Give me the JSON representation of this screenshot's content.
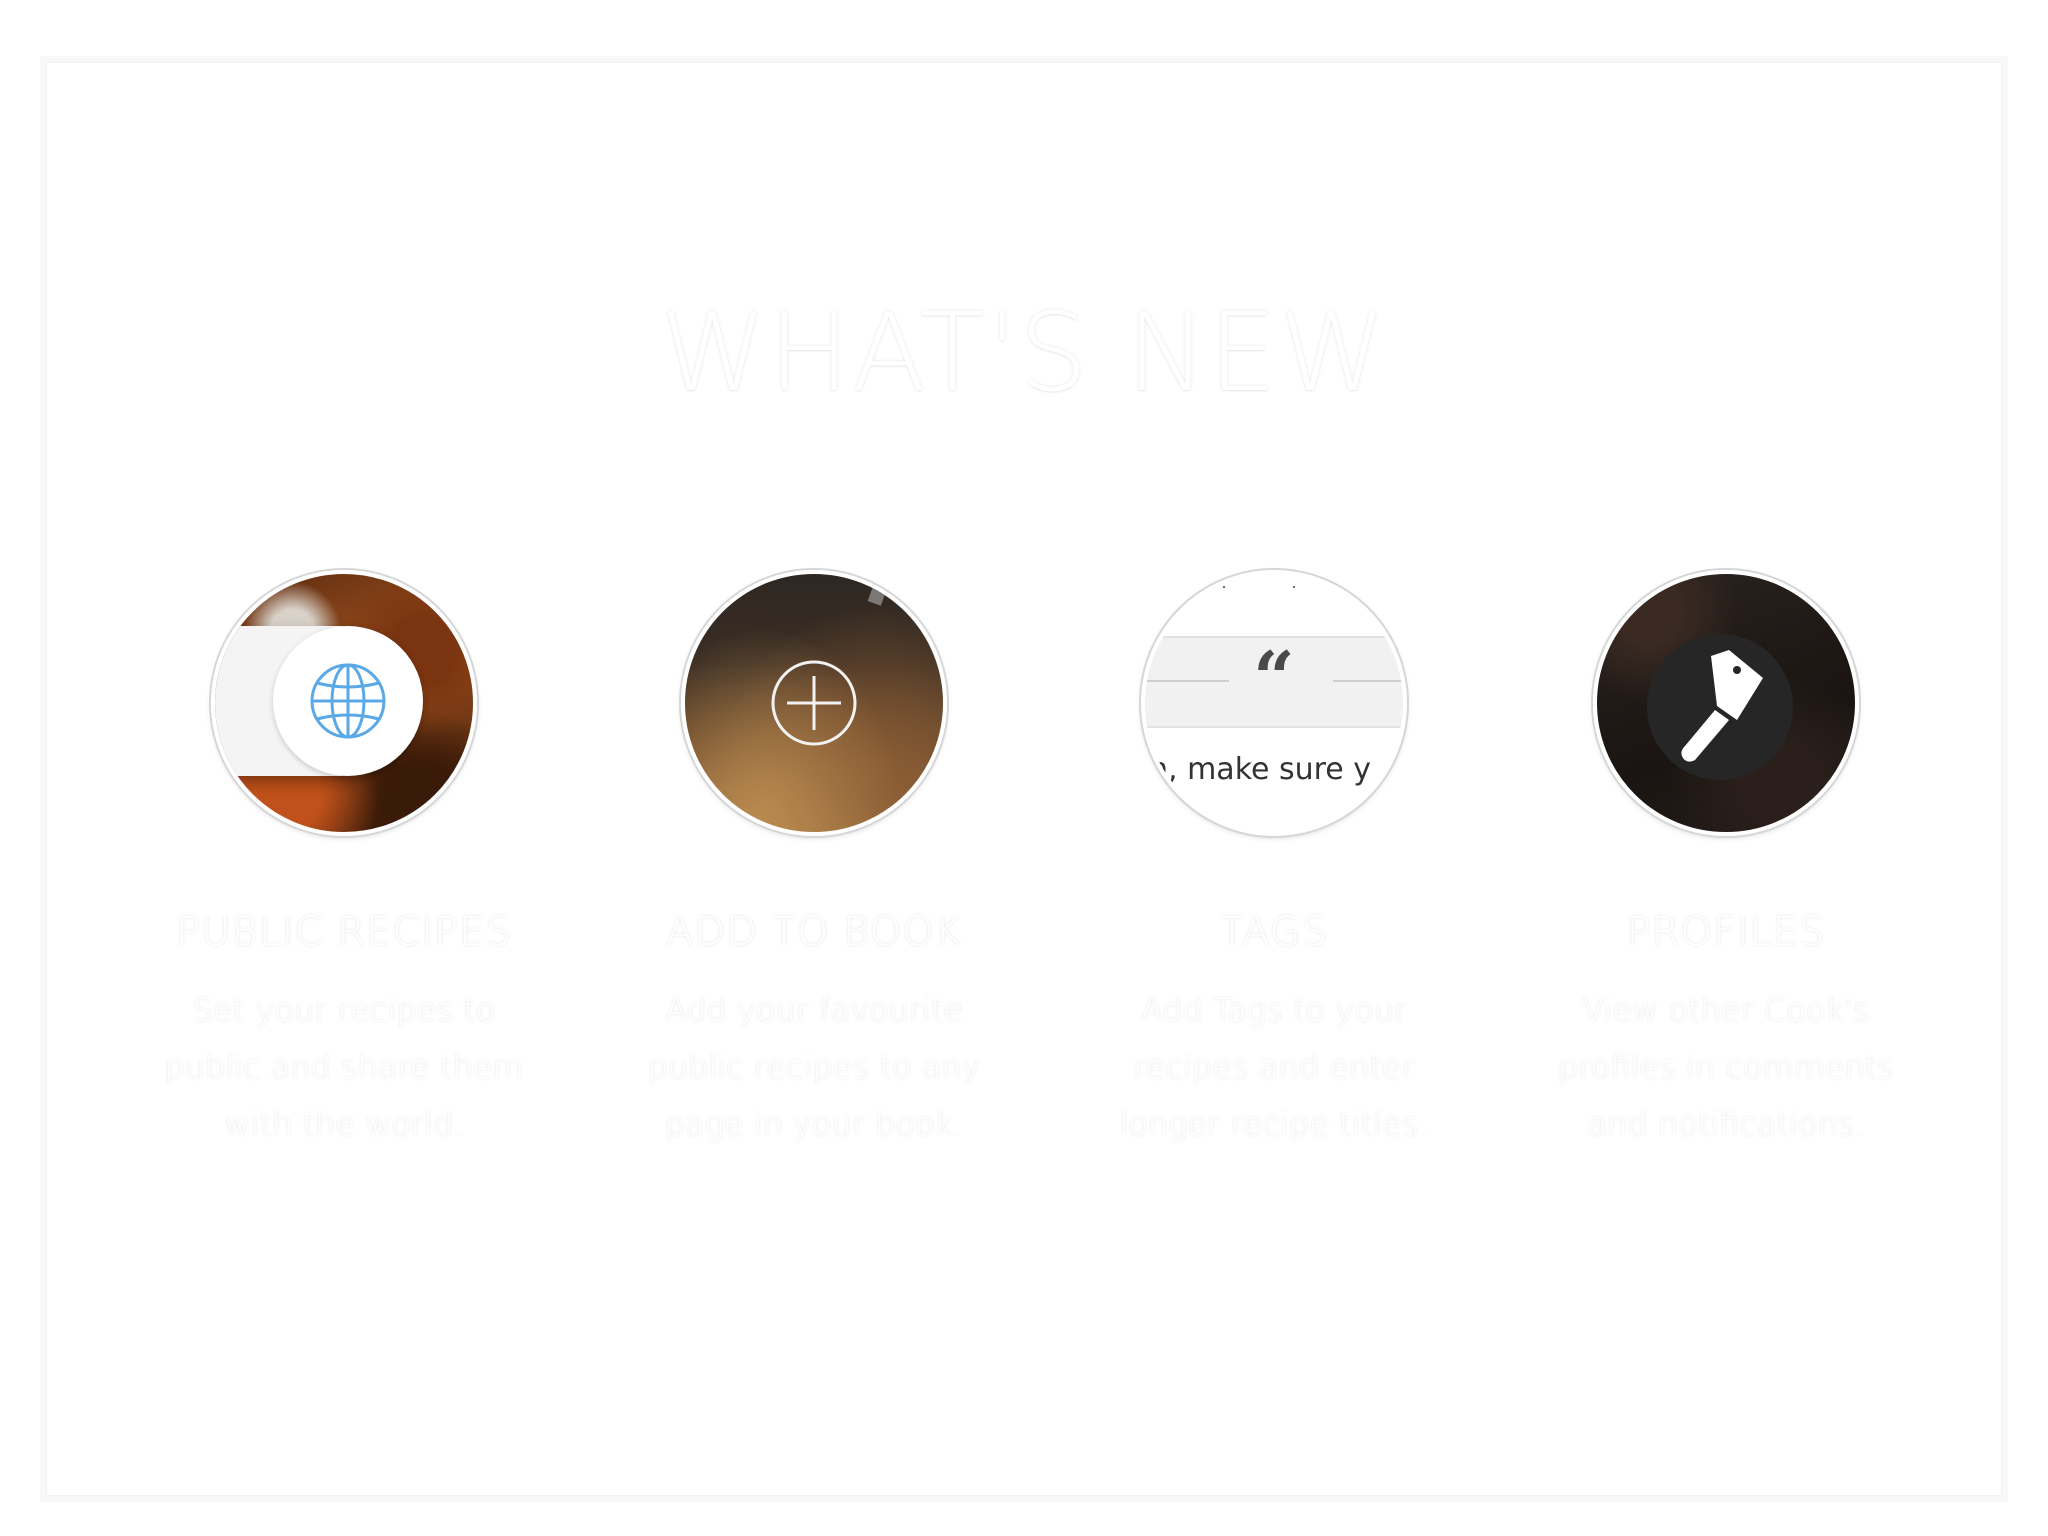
{
  "header": {
    "title": "WHAT'S NEW"
  },
  "features": [
    {
      "title": "PUBLIC RECIPES",
      "description": "Set your recipes to public and share them with the world.",
      "icon": "globe-icon"
    },
    {
      "title": "ADD TO BOOK",
      "description": "Add your favourite public recipes to any page in your book.",
      "icon": "plus-circle-icon"
    },
    {
      "title": "TAGS",
      "description": "Add Tags to your recipes and enter longer recipe titles.",
      "icon": "quote-icon",
      "preview_text": "n, make sure y"
    },
    {
      "title": "PROFILES",
      "description": "View other Cook's profiles in comments and notifications.",
      "icon": "cleaver-icon"
    }
  ],
  "colors": {
    "background": "#ffffff",
    "globe_blue": "#5aa9e6",
    "text_ghost": "#ffffff"
  }
}
